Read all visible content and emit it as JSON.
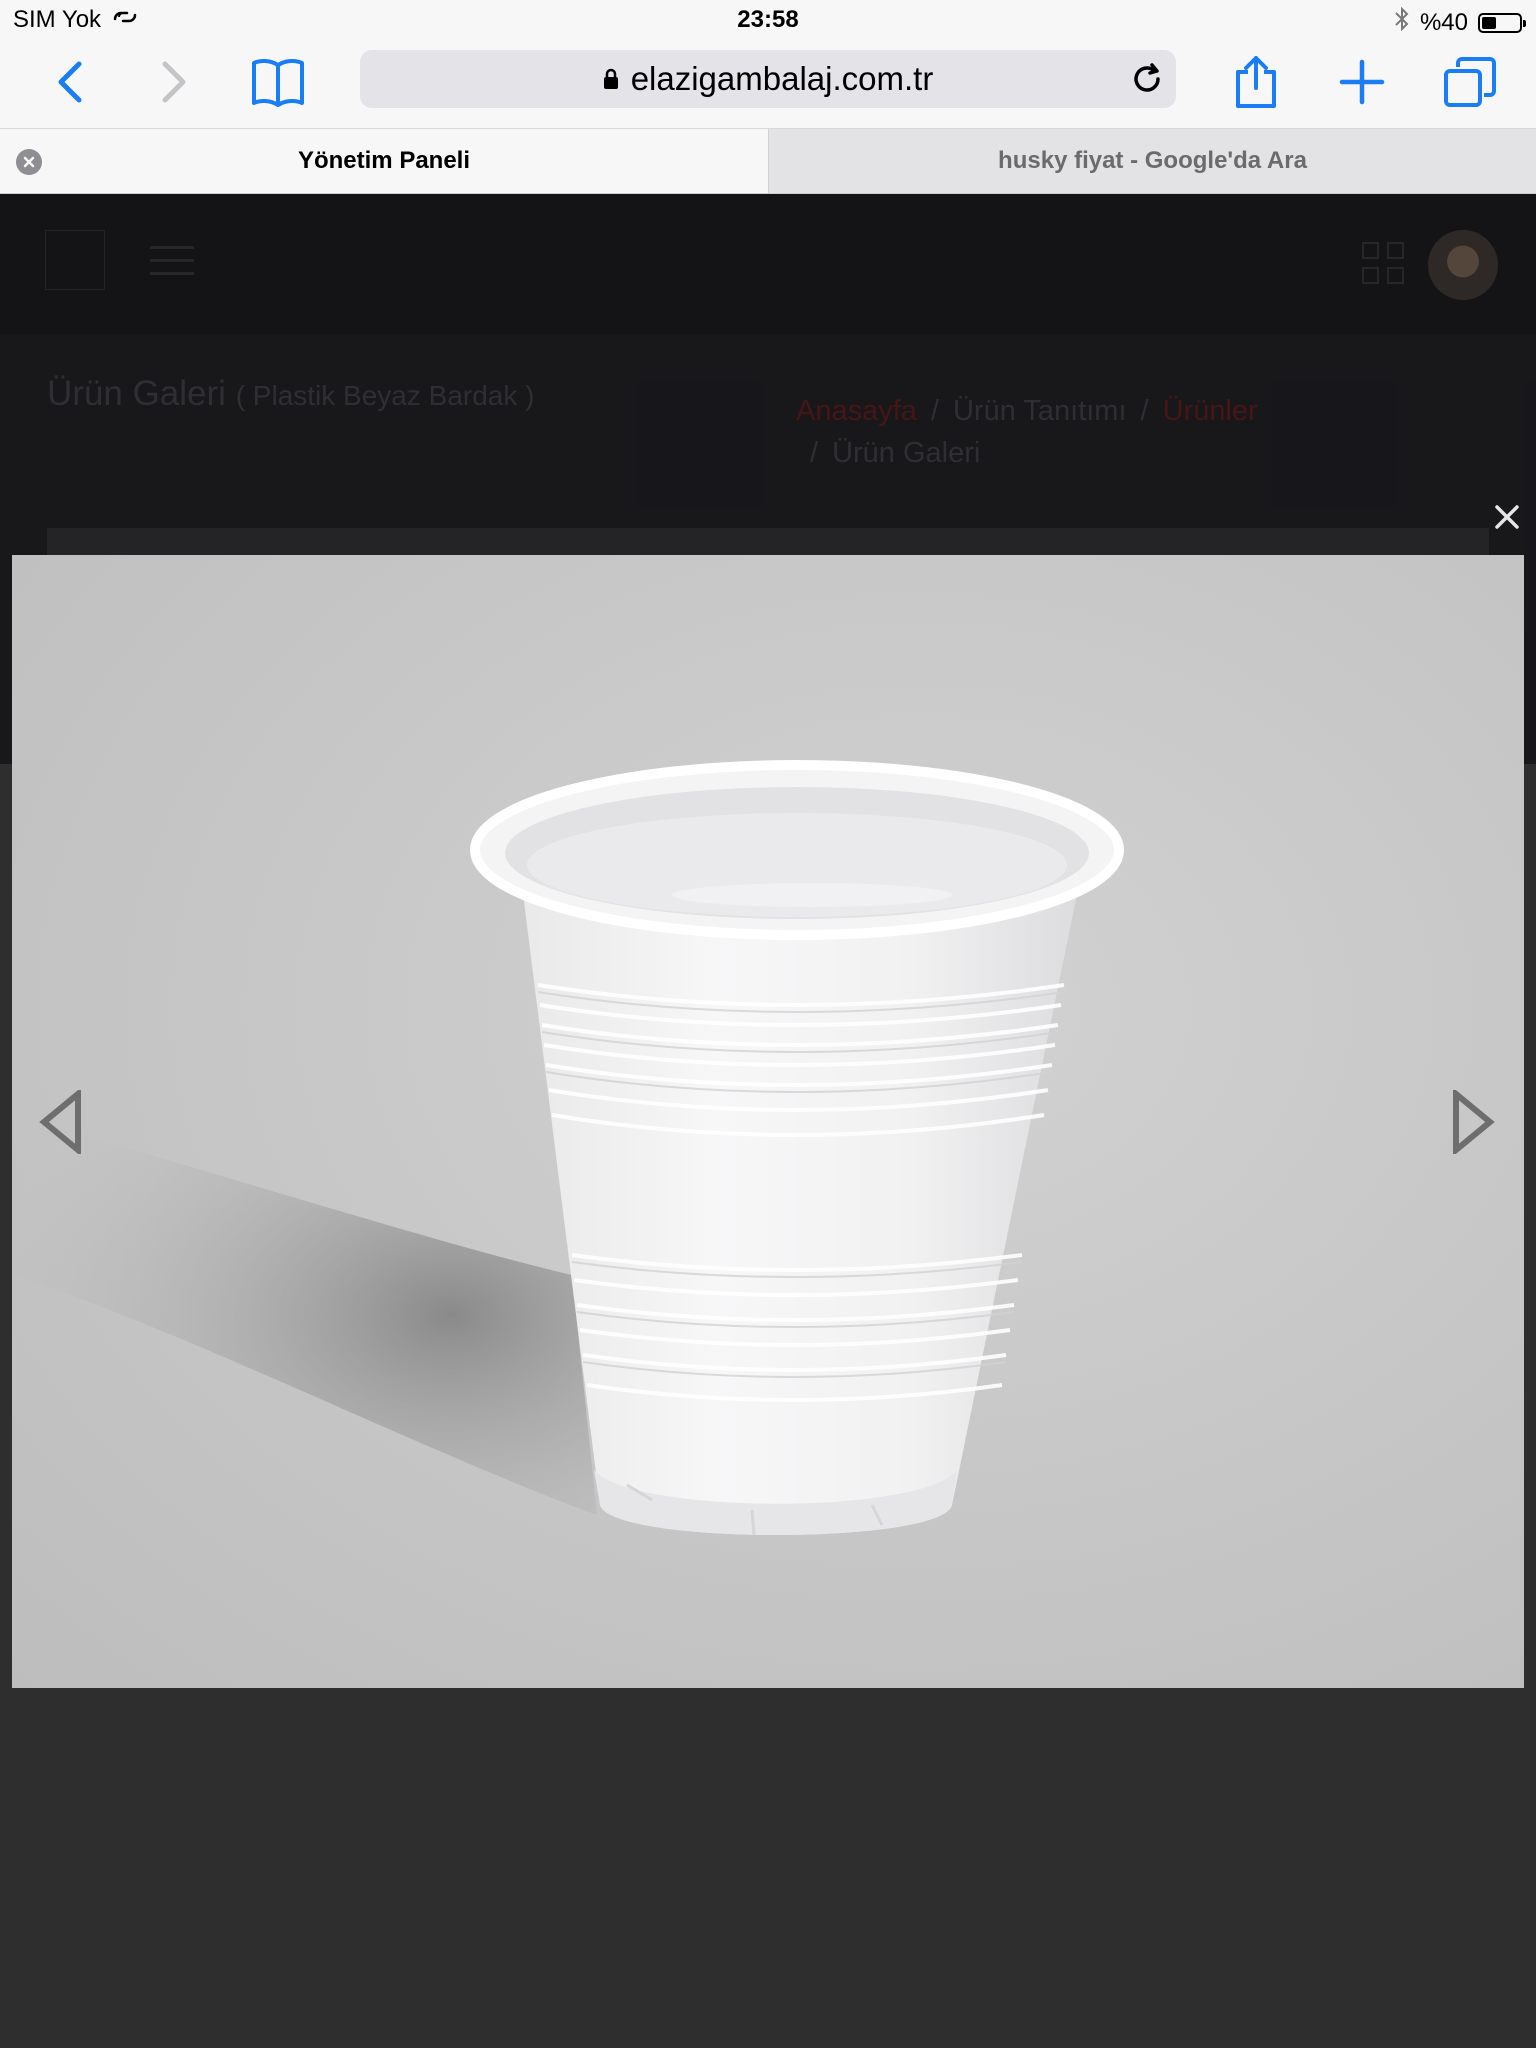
{
  "status_bar": {
    "carrier": "SIM Yok",
    "time": "23:58",
    "battery": "%40",
    "battery_level": 0.4
  },
  "toolbar": {
    "url": "elazigambalaj.com.tr",
    "icons": [
      "back-icon",
      "forward-icon",
      "bookmarks-icon",
      "lock-icon",
      "reload-icon",
      "share-icon",
      "new-tab-icon",
      "tabs-icon"
    ]
  },
  "tabs": [
    {
      "label": "Yönetim Paneli",
      "active": true
    },
    {
      "label": "husky fiyat - Google'da Ara",
      "active": false
    }
  ],
  "page": {
    "title": "Ürün Galeri",
    "subtitle_open": "( ",
    "subtitle": "Plastik Beyaz Bardak",
    "subtitle_close": " )",
    "breadcrumb": [
      "Anasayfa",
      "Ürün Tanıtımı",
      "Ürünler",
      "Ürün Galeri"
    ],
    "breadcrumb_sep": "/"
  },
  "lightbox": {
    "image": "white-plastic-cup",
    "icons": [
      "close-icon",
      "prev-arrow-icon",
      "next-arrow-icon"
    ]
  },
  "colors": {
    "ios_blue": "#1a7df5",
    "breadcrumb_red": "#5a1a1a",
    "overlay": "#3a3a3a"
  }
}
